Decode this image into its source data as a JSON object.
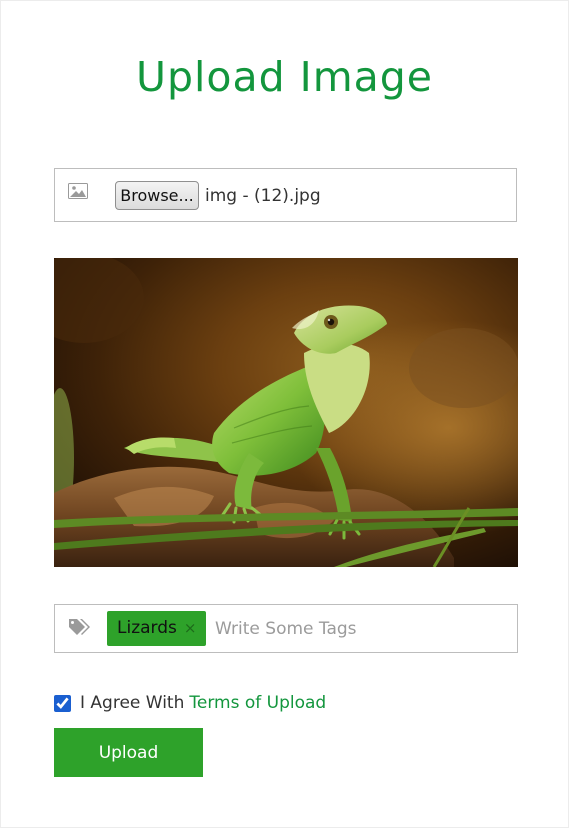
{
  "title": "Upload Image",
  "file_input": {
    "icon": "image-icon",
    "browse_label": "Browse...",
    "file_name": "img - (12).jpg"
  },
  "preview": {
    "alt": "img - (12).jpg"
  },
  "tags": {
    "icon": "tags-icon",
    "items": [
      {
        "label": "Lizards",
        "remove": "×"
      }
    ],
    "placeholder": "Write Some Tags"
  },
  "agree": {
    "checked": true,
    "text": "I Agree With",
    "link_text": "Terms of Upload"
  },
  "upload_button": {
    "label": "Upload"
  },
  "colors": {
    "accent": "#13963d",
    "button": "#2ea22a",
    "border": "#bdbdbd"
  }
}
